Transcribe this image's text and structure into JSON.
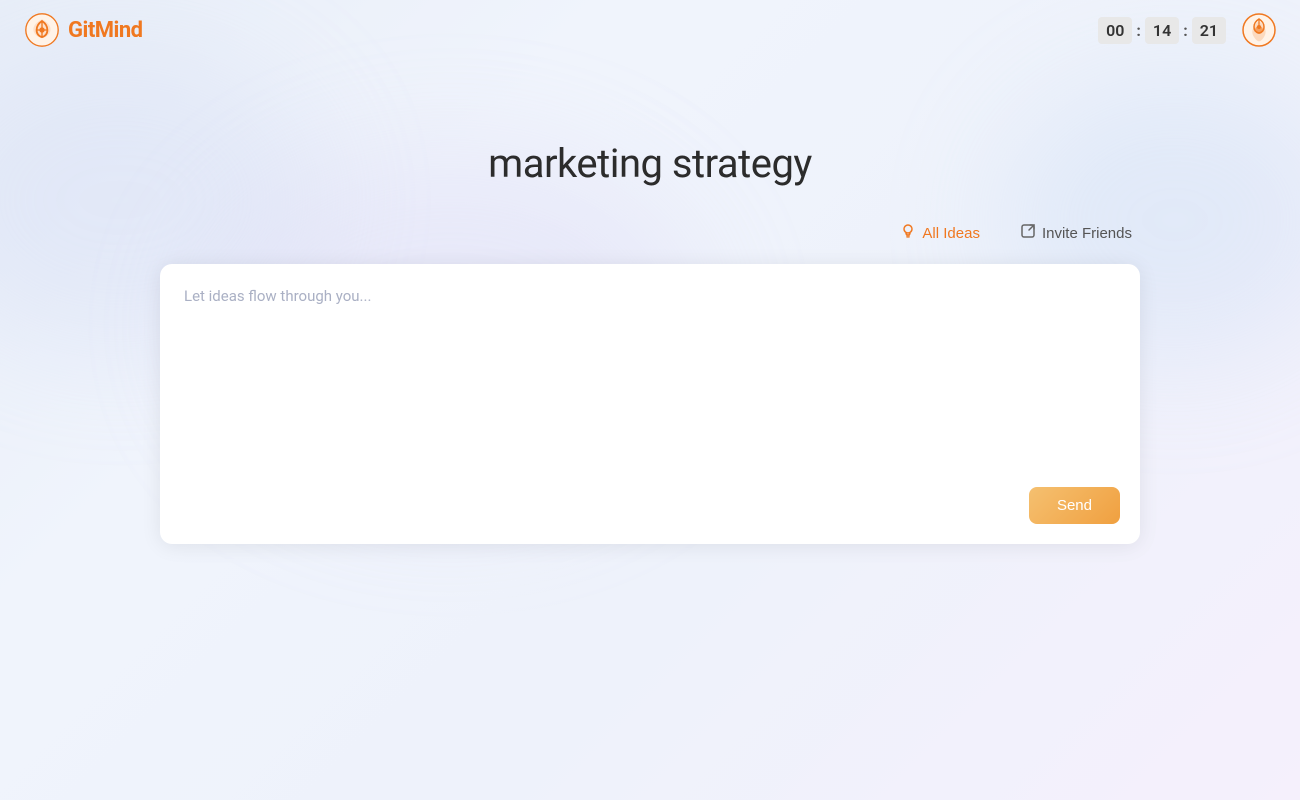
{
  "header": {
    "logo_text": "GitMind",
    "timer": {
      "hours": "00",
      "minutes": "14",
      "seconds": "21",
      "colon": ":"
    }
  },
  "main": {
    "page_title": "marketing strategy",
    "action_bar": {
      "all_ideas_label": "All Ideas",
      "invite_friends_label": "Invite Friends"
    },
    "input_area": {
      "placeholder": "Let ideas flow through you...",
      "send_button_label": "Send"
    }
  },
  "colors": {
    "accent": "#f07820",
    "send_button_gradient_start": "#f5c070",
    "send_button_gradient_end": "#f0a040"
  }
}
